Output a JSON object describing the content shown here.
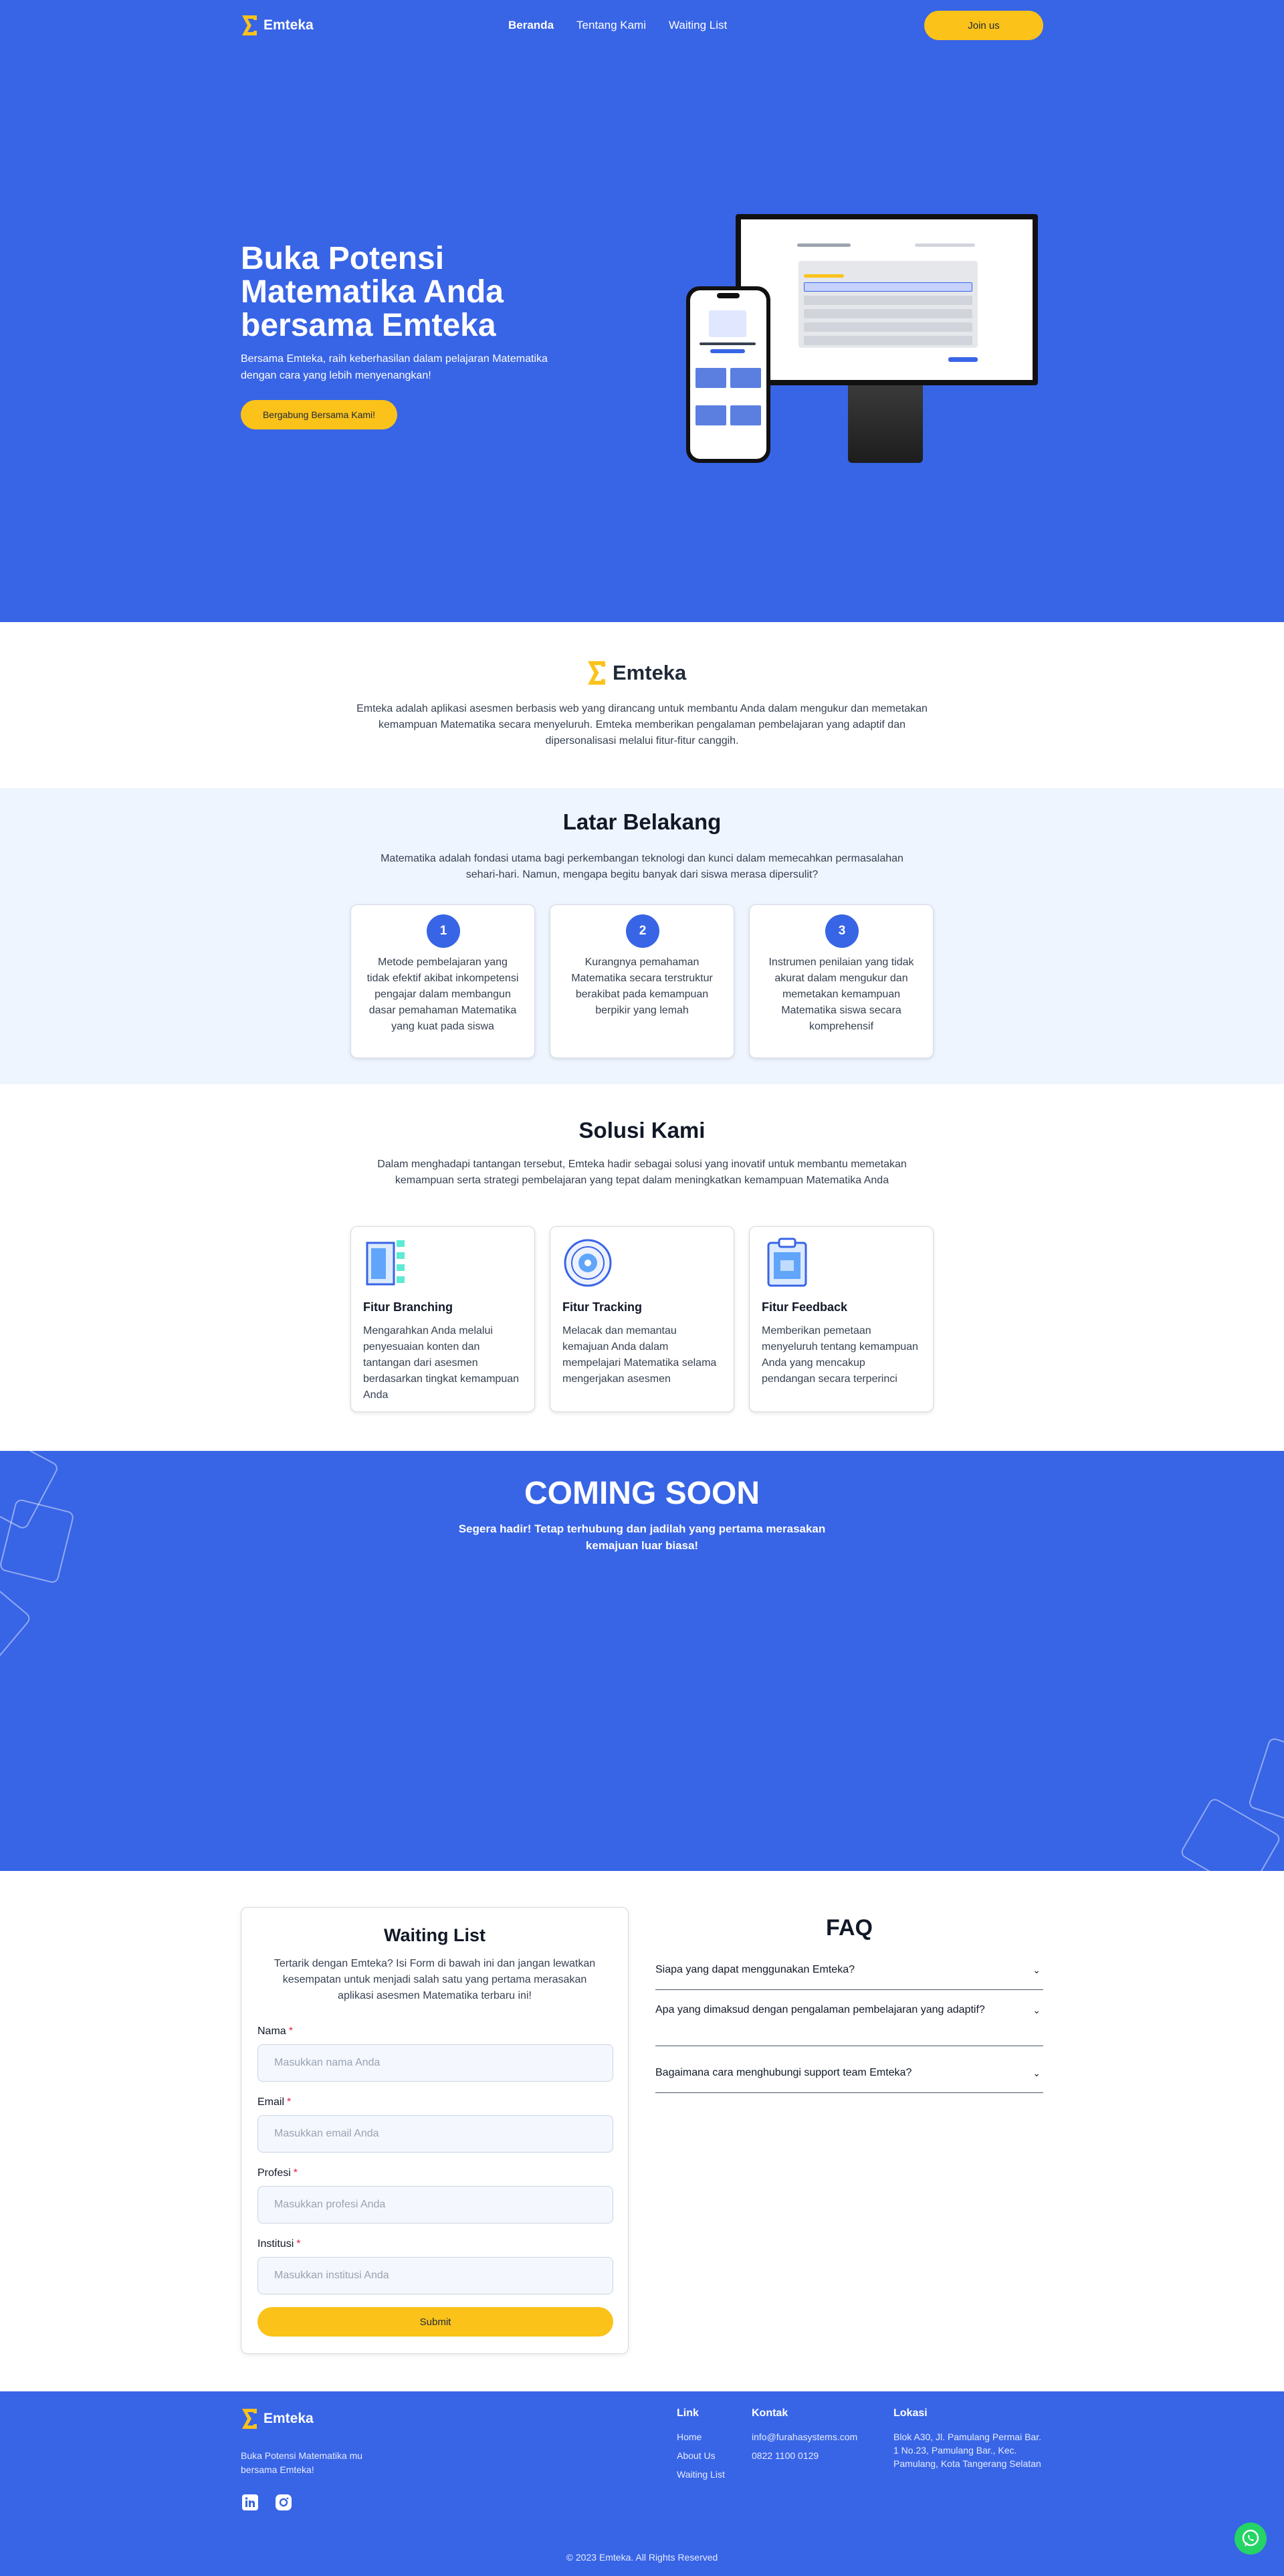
{
  "brand": {
    "name": "Emteka",
    "color": "#3864e6",
    "accent": "#fbc21a"
  },
  "nav": {
    "links": [
      "Beranda",
      "Tentang Kami",
      "Waiting List"
    ],
    "join_label": "Join us"
  },
  "hero": {
    "title": "Buka Potensi Matematika Anda bersama Emteka",
    "subtitle": "Bersama Emteka, raih keberhasilan dalam pelajaran Matematika dengan cara yang lebih menyenangkan!",
    "cta": "Bergabung Bersama Kami!"
  },
  "about": {
    "text": "Emteka adalah aplikasi asesmen berbasis web yang dirancang untuk membantu Anda dalam mengukur dan memetakan kemampuan Matematika secara menyeluruh. Emteka memberikan pengalaman pembelajaran yang adaptif dan dipersonalisasi melalui fitur-fitur canggih."
  },
  "latar": {
    "title": "Latar Belakang",
    "subtitle": "Matematika adalah fondasi utama bagi perkembangan teknologi dan kunci dalam memecahkan permasalahan sehari-hari. Namun, mengapa begitu banyak dari siswa merasa dipersulit?",
    "cards": [
      {
        "num": "1",
        "text": "Metode pembelajaran yang tidak efektif akibat inkompetensi pengajar dalam membangun dasar pemahaman Matematika yang kuat pada siswa"
      },
      {
        "num": "2",
        "text": "Kurangnya pemahaman Matematika secara terstruktur berakibat pada kemampuan berpikir yang lemah"
      },
      {
        "num": "3",
        "text": "Instrumen penilaian yang tidak akurat dalam mengukur dan memetakan kemampuan Matematika siswa secara komprehensif"
      }
    ]
  },
  "solusi": {
    "title": "Solusi Kami",
    "subtitle": "Dalam menghadapi tantangan tersebut, Emteka hadir sebagai solusi yang inovatif untuk membantu memetakan kemampuan serta strategi pembelajaran yang tepat dalam meningkatkan kemampuan Matematika Anda",
    "features": [
      {
        "title": "Fitur Branching",
        "desc": "Mengarahkan Anda melalui penyesuaian konten dan tantangan dari asesmen berdasarkan tingkat kemampuan Anda",
        "icon": "branching-icon"
      },
      {
        "title": "Fitur Tracking",
        "desc": "Melacak dan memantau kemajuan Anda dalam mempelajari Matematika selama mengerjakan asesmen",
        "icon": "tracking-icon"
      },
      {
        "title": "Fitur Feedback",
        "desc": "Memberikan pemetaan menyeluruh tentang kemampuan Anda yang mencakup pendangan secara terperinci",
        "icon": "feedback-icon"
      }
    ]
  },
  "coming": {
    "title": "COMING SOON",
    "subtitle": "Segera hadir! Tetap terhubung dan jadilah yang pertama merasakan kemajuan luar biasa!"
  },
  "waitlist": {
    "title": "Waiting List",
    "subtitle": "Tertarik dengan Emteka? Isi Form di bawah ini dan jangan lewatkan kesempatan untuk menjadi salah satu yang pertama merasakan aplikasi asesmen Matematika terbaru ini!",
    "fields": [
      {
        "label": "Nama",
        "placeholder": "Masukkan nama Anda",
        "value": ""
      },
      {
        "label": "Email",
        "placeholder": "Masukkan email Anda",
        "value": ""
      },
      {
        "label": "Profesi",
        "placeholder": "Masukkan profesi Anda",
        "value": ""
      },
      {
        "label": "Institusi",
        "placeholder": "Masukkan institusi Anda",
        "value": ""
      }
    ],
    "required_mark": "*",
    "submit": "Submit"
  },
  "faq": {
    "title": "FAQ",
    "items": [
      "Siapa yang dapat menggunakan Emteka?",
      "Apa yang dimaksud dengan pengalaman pembelajaran yang adaptif?",
      "Bagaimana cara menghubungi support team Emteka?"
    ]
  },
  "footer": {
    "tagline": "Buka Potensi Matematika mu bersama Emteka!",
    "link_title": "Link",
    "links": [
      "Home",
      "About Us",
      "Waiting List"
    ],
    "contact_title": "Kontak",
    "contacts": [
      "info@furahasystems.com",
      "0822 1100 0129"
    ],
    "location_title": "Lokasi",
    "location": "Blok A30, Jl. Pamulang Permai Bar. 1 No.23, Pamulang Bar., Kec. Pamulang, Kota Tangerang Selatan",
    "copyright": "© 2023 Emteka. All Rights Reserved"
  }
}
